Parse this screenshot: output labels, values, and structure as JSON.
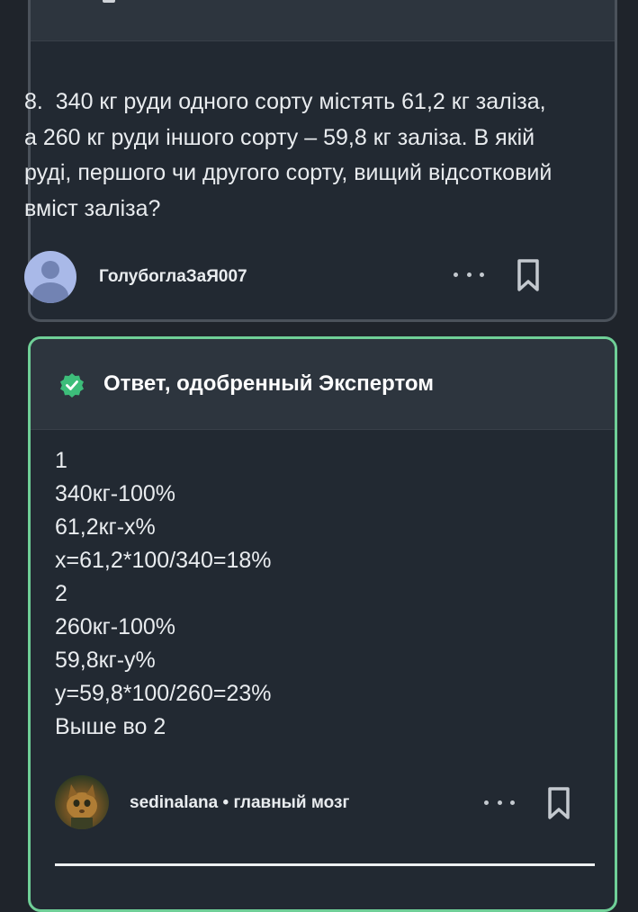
{
  "question": {
    "number": "8.",
    "text": "340 кг руди одного сорту містять 61,2 кг заліза, а 260 кг руди іншого сорту – 59,8 кг заліза. В якій руді, першого чи другого сорту, вищий відсотковий вміст заліза?",
    "author": "ГолубоглаЗаЯ007"
  },
  "answer": {
    "badge_label": "Ответ, одобренный Экспертом",
    "lines": [
      "1",
      "340кг-100%",
      "61,2кг-х%",
      "х=61,2*100/340=18%",
      "2",
      "260кг-100%",
      "59,8кг-у%",
      "у=59,8*100/260=23%",
      "Выше во 2"
    ],
    "author": "sedinalana",
    "author_rank": "главный мозг"
  },
  "colors": {
    "background": "#1f242b",
    "card": "#222932",
    "card_border": "#4b525b",
    "accent_green": "#6fcf97",
    "check_green": "#3dbd7a"
  },
  "icons": [
    "more-dots-icon",
    "bookmark-icon",
    "verified-check-icon",
    "default-avatar-icon"
  ]
}
